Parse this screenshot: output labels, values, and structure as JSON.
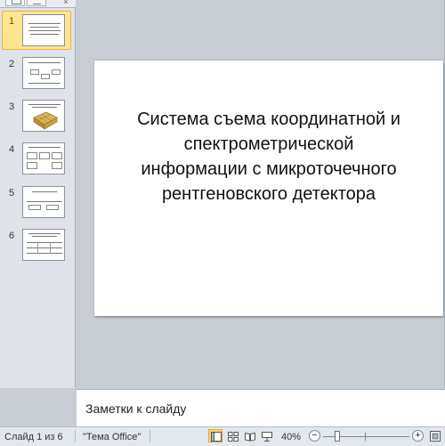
{
  "thumbnails": [
    {
      "number": "1",
      "active": true
    },
    {
      "number": "2",
      "active": false
    },
    {
      "number": "3",
      "active": false
    },
    {
      "number": "4",
      "active": false
    },
    {
      "number": "5",
      "active": false
    },
    {
      "number": "6",
      "active": false
    }
  ],
  "slide": {
    "title": "Система съема координатной и\nспектрометрической\nинформации  с микроточечного\nрентгеновского детектора"
  },
  "notes": {
    "placeholder": "Заметки к слайду"
  },
  "status_bar": {
    "slide_indicator": "Слайд 1 из 6",
    "theme": "\"Тема Office\"",
    "zoom_level": "40%",
    "zoom_fraction": 0.4,
    "minus_glyph": "−",
    "plus_glyph": "+"
  },
  "icons": {
    "normal_view": "normal-view-icon",
    "slide_sorter": "slide-sorter-icon",
    "reading_view": "reading-view-icon",
    "slide_show": "slide-show-icon",
    "fit_to_window": "fit-to-window-icon"
  },
  "colors": {
    "active_thumb": "#fde68f",
    "active_view": "#fbd46c",
    "workspace": "#c8ccd3"
  }
}
